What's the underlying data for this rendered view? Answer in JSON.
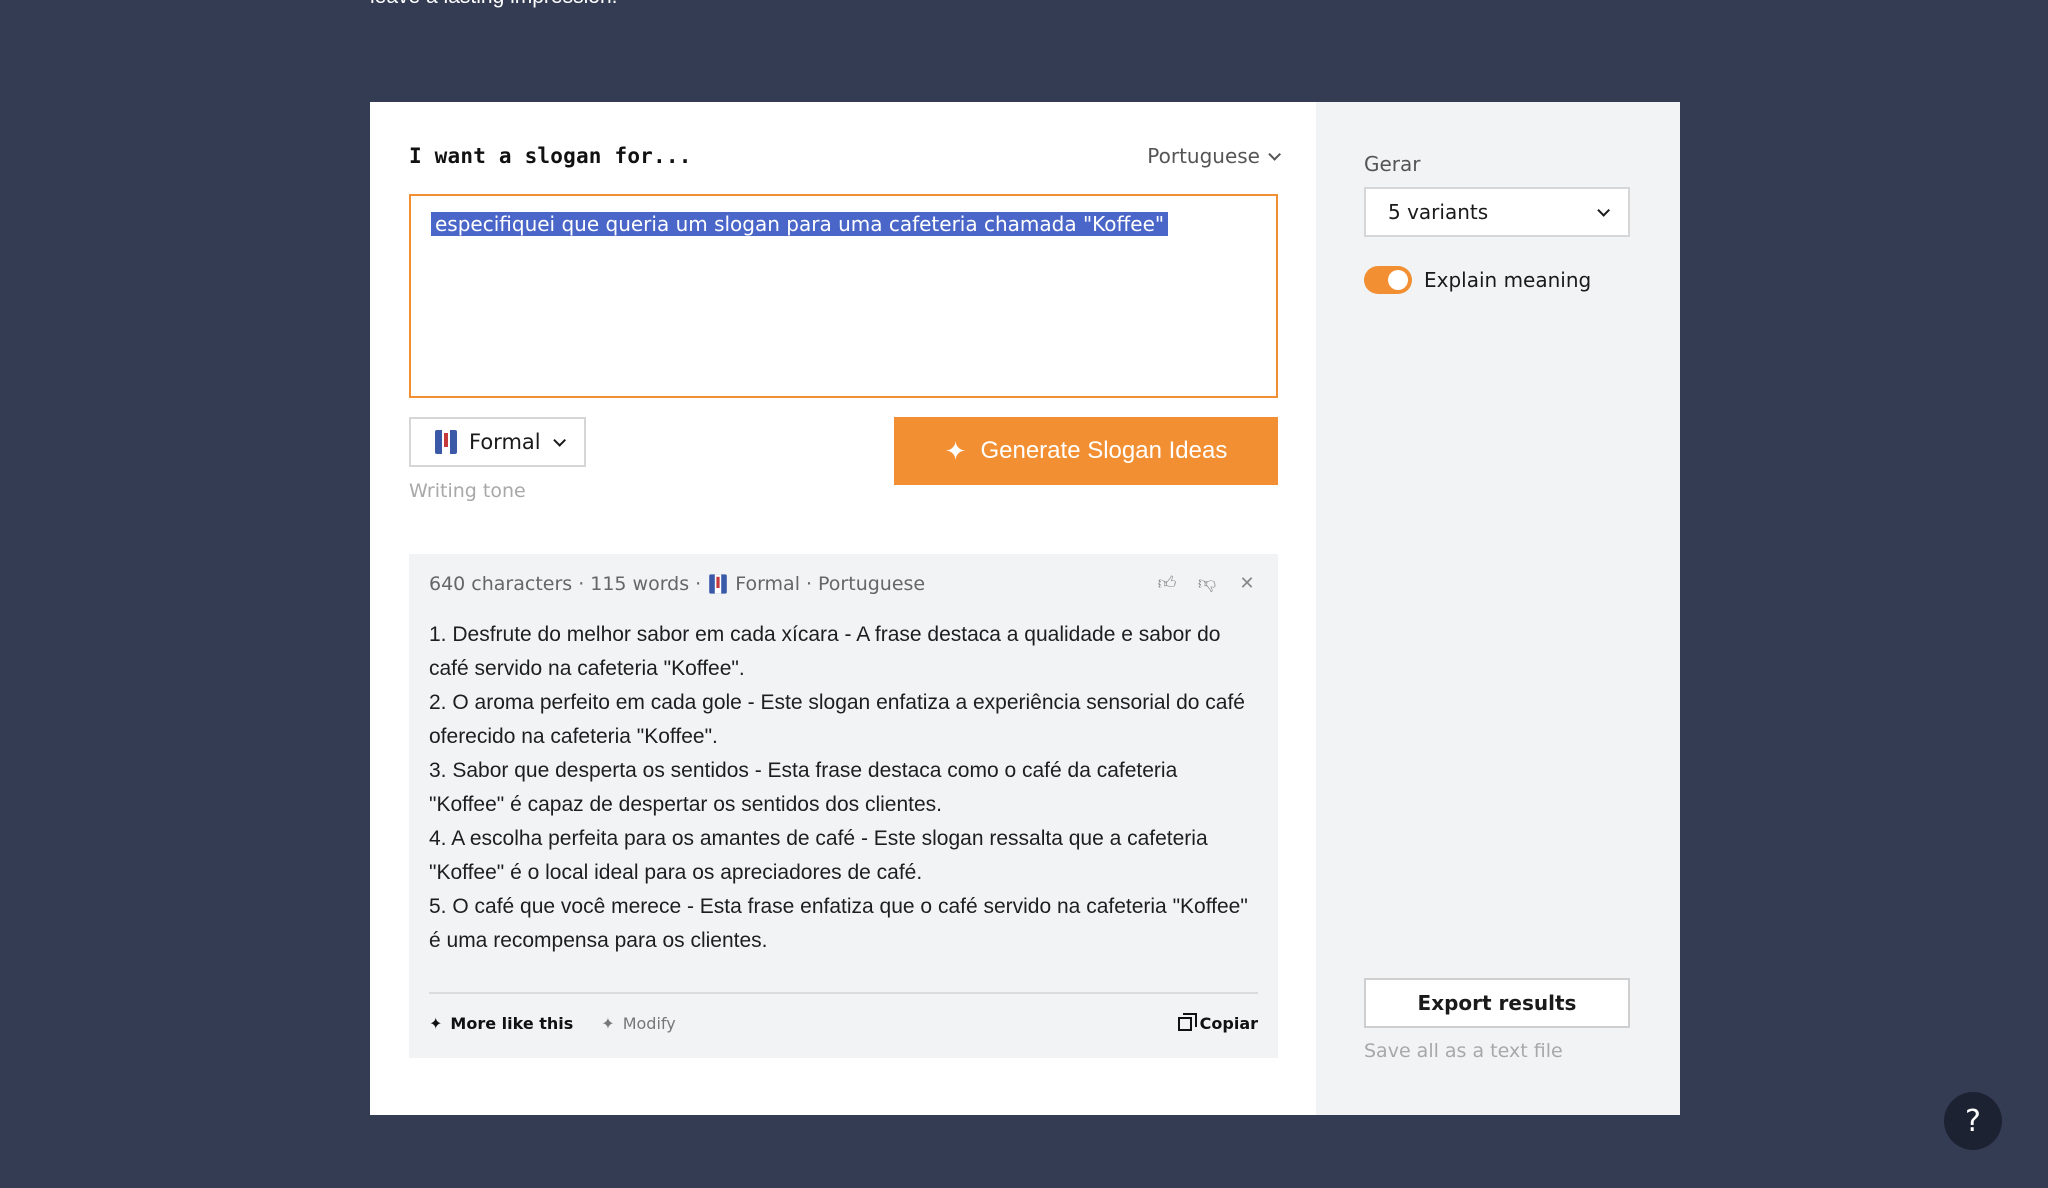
{
  "intro": {
    "text": "leave a lasting impression."
  },
  "form": {
    "label": "I want a slogan for...",
    "language": "Portuguese",
    "input_value": "especifiquei que queria um slogan para uma cafeteria chamada \"Koffee\"",
    "tone": "Formal",
    "tone_hint": "Writing tone",
    "generate_label": "Generate Slogan Ideas"
  },
  "result": {
    "chars": "640 characters",
    "words": "115 words",
    "tone": "Formal",
    "language": "Portuguese",
    "lines": [
      "1. Desfrute do melhor sabor em cada xícara - A frase destaca a qualidade e sabor do café servido na cafeteria \"Koffee\".",
      "2. O aroma perfeito em cada gole - Este slogan enfatiza a experiência sensorial do café oferecido na cafeteria \"Koffee\".",
      "3. Sabor que desperta os sentidos - Esta frase destaca como o café da cafeteria \"Koffee\" é capaz de despertar os sentidos dos clientes.",
      "4. A escolha perfeita para os amantes de café - Este slogan ressalta que a cafeteria \"Koffee\" é o local ideal para os apreciadores de café.",
      "5. O café que você merece - Esta frase enfatiza que o café servido na cafeteria \"Koffee\" é uma recompensa para os clientes."
    ],
    "more_label": "More like this",
    "modify_label": "Modify",
    "copy_label": "Copiar"
  },
  "sidebar": {
    "gerar_label": "Gerar",
    "variants": "5 variants",
    "explain_label": "Explain meaning",
    "explain_on": true,
    "export_label": "Export results",
    "export_hint": "Save all as a text file"
  },
  "help": {
    "label": "?"
  },
  "colors": {
    "background": "#343c54",
    "accent": "#f28f32",
    "selection": "#4a66c9"
  }
}
